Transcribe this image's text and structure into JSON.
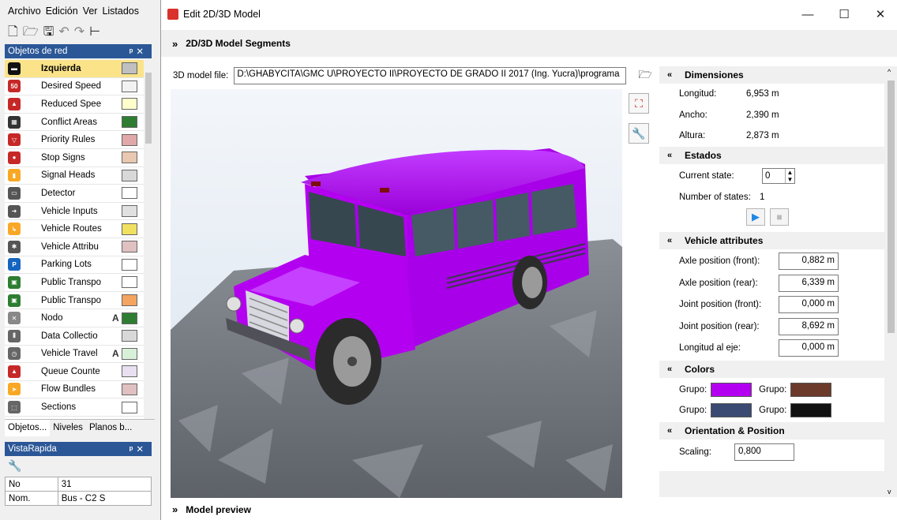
{
  "host": {
    "menu": [
      "Archivo",
      "Edición",
      "Ver",
      "Listados"
    ],
    "objects_panel_title": "Objetos de red",
    "objects": [
      {
        "label": "Izquierda",
        "icon": "link-icon",
        "icon_color": "#111111",
        "swatch": "#c0c0c0",
        "selected": true,
        "A": ""
      },
      {
        "label": "Desired Speed",
        "icon": "speed-sign-icon",
        "icon_color": "#c62828",
        "swatch": "#f2f2f2",
        "selected": false,
        "A": ""
      },
      {
        "label": "Reduced Spee",
        "icon": "warning-sign-icon",
        "icon_color": "#c62828",
        "swatch": "#ffffcc",
        "selected": false,
        "A": ""
      },
      {
        "label": "Conflict Areas",
        "icon": "conflict-icon",
        "icon_color": "#333333",
        "swatch": "#2e7d32",
        "selected": false,
        "A": ""
      },
      {
        "label": "Priority Rules",
        "icon": "yield-sign-icon",
        "icon_color": "#c62828",
        "swatch": "#e0a8a8",
        "selected": false,
        "A": ""
      },
      {
        "label": "Stop Signs",
        "icon": "stop-sign-icon",
        "icon_color": "#c62828",
        "swatch": "#e8c8b0",
        "selected": false,
        "A": ""
      },
      {
        "label": "Signal Heads",
        "icon": "traffic-light-icon",
        "icon_color": "#f9a825",
        "swatch": "#d8d8d8",
        "selected": false,
        "A": ""
      },
      {
        "label": "Detector",
        "icon": "detector-icon",
        "icon_color": "#555555",
        "swatch": "#ffffff",
        "selected": false,
        "A": ""
      },
      {
        "label": "Vehicle Inputs",
        "icon": "vehicle-input-icon",
        "icon_color": "#555555",
        "swatch": "#e0e0e0",
        "selected": false,
        "A": ""
      },
      {
        "label": "Vehicle Routes",
        "icon": "route-icon",
        "icon_color": "#f9a825",
        "swatch": "#f0e060",
        "selected": false,
        "A": ""
      },
      {
        "label": "Vehicle Attribu",
        "icon": "vehicle-attribute-icon",
        "icon_color": "#555555",
        "swatch": "#e0c0c0",
        "selected": false,
        "A": ""
      },
      {
        "label": "Parking Lots",
        "icon": "parking-icon",
        "icon_color": "#1565c0",
        "swatch": "#ffffff",
        "selected": false,
        "A": ""
      },
      {
        "label": "Public Transpo",
        "icon": "bus-stop-icon",
        "icon_color": "#2e7d32",
        "swatch": "#ffffff",
        "selected": false,
        "A": ""
      },
      {
        "label": "Public Transpo",
        "icon": "bus-line-icon",
        "icon_color": "#2e7d32",
        "swatch": "#f4a460",
        "selected": false,
        "A": ""
      },
      {
        "label": "Nodo",
        "icon": "node-icon",
        "icon_color": "#888888",
        "swatch": "#2e7d32",
        "selected": false,
        "A": "A"
      },
      {
        "label": "Data Collectio",
        "icon": "data-collection-icon",
        "icon_color": "#666666",
        "swatch": "#d8d8d8",
        "selected": false,
        "A": ""
      },
      {
        "label": "Vehicle Travel",
        "icon": "stopwatch-icon",
        "icon_color": "#666666",
        "swatch": "#d8f0d8",
        "selected": false,
        "A": "A"
      },
      {
        "label": "Queue Counte",
        "icon": "queue-counter-icon",
        "icon_color": "#c62828",
        "swatch": "#e8e0f0",
        "selected": false,
        "A": ""
      },
      {
        "label": "Flow Bundles",
        "icon": "flow-bundle-icon",
        "icon_color": "#f9a825",
        "swatch": "#e0c0c0",
        "selected": false,
        "A": ""
      },
      {
        "label": "Sections",
        "icon": "sections-icon",
        "icon_color": "#666666",
        "swatch": "#ffffff",
        "selected": false,
        "A": ""
      }
    ],
    "tabs": [
      "Objetos...",
      "Niveles",
      "Planos b..."
    ],
    "quickview_title": "VistaRapida",
    "quickview_rows": [
      {
        "key": "No",
        "value": "31"
      },
      {
        "key": "Nom.",
        "value": "Bus - C2 S"
      }
    ]
  },
  "dialog": {
    "title": "Edit 2D/3D Model",
    "segments_label": "2D/3D Model Segments",
    "model_file_label": "3D model file:",
    "model_file_value": "D:\\GHABYCITA\\GMC  U\\PROYECTO II\\PROYECTO DE GRADO II 2017 (Ing. Yucra)\\programa",
    "preview_label": "Model preview",
    "bus_color": "#b400f0",
    "sections": {
      "dimensions": {
        "title": "Dimensiones",
        "rows": [
          {
            "label": "Longitud:",
            "value": "6,953 m"
          },
          {
            "label": "Ancho:",
            "value": "2,390 m"
          },
          {
            "label": "Altura:",
            "value": "2,873 m"
          }
        ]
      },
      "states": {
        "title": "Estados",
        "current_state_label": "Current state:",
        "current_state_value": "0",
        "number_states_label": "Number of states:",
        "number_states_value": "1"
      },
      "vehicle_attributes": {
        "title": "Vehicle attributes",
        "rows": [
          {
            "label": "Axle position (front):",
            "value": "0,882 m"
          },
          {
            "label": "Axle position (rear):",
            "value": "6,339 m"
          },
          {
            "label": "Joint position (front):",
            "value": "0,000 m"
          },
          {
            "label": "Joint position (rear):",
            "value": "8,692 m"
          },
          {
            "label": "Longitud al eje:",
            "value": "0,000 m"
          }
        ]
      },
      "colors": {
        "title": "Colors",
        "items": [
          {
            "label": "Grupo:",
            "color": "#b400f0"
          },
          {
            "label": "Grupo:",
            "color": "#6b3a2a"
          },
          {
            "label": "Grupo:",
            "color": "#3b4a72"
          },
          {
            "label": "Grupo:",
            "color": "#111111"
          }
        ]
      },
      "orientation": {
        "title": "Orientation & Position",
        "scaling_label": "Scaling:",
        "scaling_value": "0,800"
      }
    }
  }
}
